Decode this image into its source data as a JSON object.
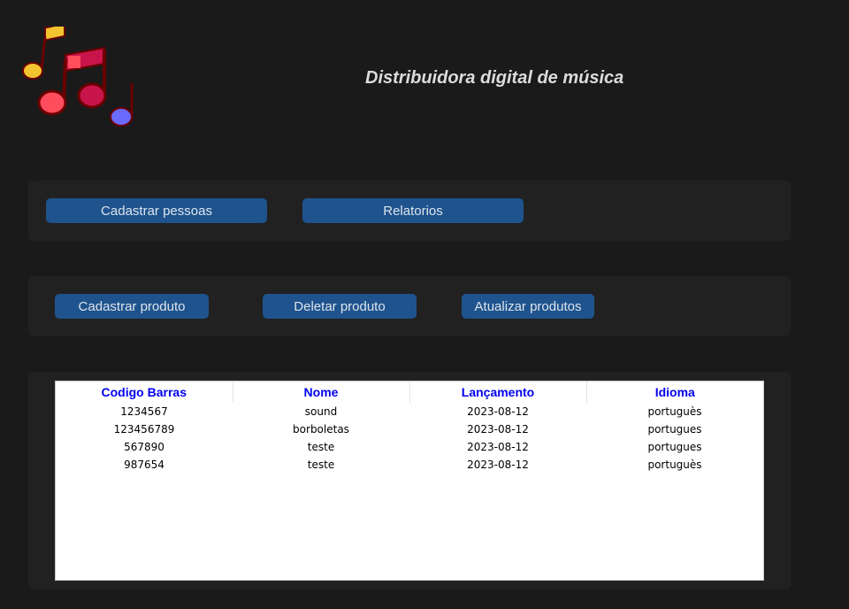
{
  "header": {
    "title": "Distribuidora digital de música"
  },
  "logo": {
    "icon": "music-notes-icon",
    "colors": [
      "#f4c430",
      "#ff4d5e",
      "#c8144a",
      "#6a6aff",
      "#6b0000"
    ]
  },
  "nav": {
    "cadastrar_pessoas": "Cadastrar pessoas",
    "relatorios": "Relatorios"
  },
  "actions": {
    "cadastrar_produto": "Cadastrar produto",
    "deletar_produto": "Deletar produto",
    "atualizar_produtos": "Atualizar produtos"
  },
  "table": {
    "columns": [
      "Codigo Barras",
      "Nome",
      "Lançamento",
      "Idioma"
    ],
    "rows": [
      [
        "1234567",
        "sound",
        "2023-08-12",
        "portuguès"
      ],
      [
        "123456789",
        "borboletas",
        "2023-08-12",
        "portugues"
      ],
      [
        "567890",
        "teste",
        "2023-08-12",
        "portugues"
      ],
      [
        "987654",
        "teste",
        "2023-08-12",
        "portuguès"
      ]
    ]
  },
  "theme": {
    "background": "#1a1a1a",
    "frame": "#212121",
    "button": "#1f538d",
    "header_text": "#0000ee"
  }
}
